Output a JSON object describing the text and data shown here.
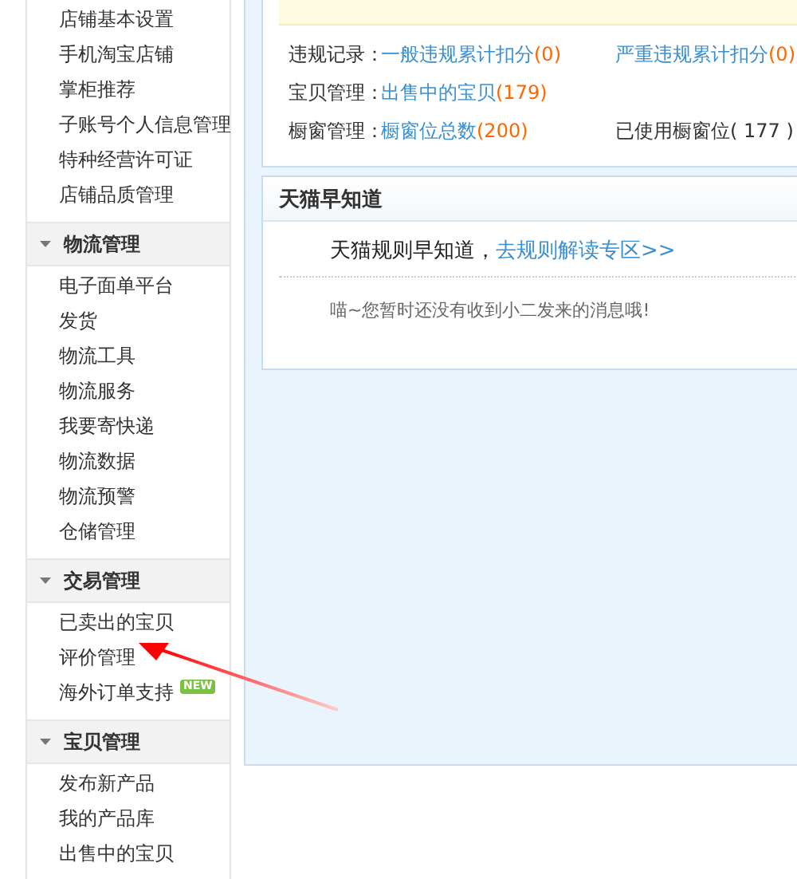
{
  "sidebar": {
    "groups": [
      {
        "items": [
          {
            "label": "店铺基本设置"
          },
          {
            "label": "手机淘宝店铺"
          },
          {
            "label": "掌柜推荐"
          },
          {
            "label": "子账号个人信息管理"
          },
          {
            "label": "特种经营许可证"
          },
          {
            "label": "店铺品质管理"
          }
        ]
      },
      {
        "title": "物流管理",
        "expanded": true,
        "items": [
          {
            "label": "电子面单平台"
          },
          {
            "label": "发货"
          },
          {
            "label": "物流工具"
          },
          {
            "label": "物流服务"
          },
          {
            "label": "我要寄快递"
          },
          {
            "label": "物流数据"
          },
          {
            "label": "物流预警"
          },
          {
            "label": "仓储管理"
          }
        ]
      },
      {
        "title": "交易管理",
        "expanded": true,
        "items": [
          {
            "label": "已卖出的宝贝"
          },
          {
            "label": "评价管理"
          },
          {
            "label": "海外订单支持",
            "badge": "NEW"
          }
        ]
      },
      {
        "title": "宝贝管理",
        "expanded": true,
        "items": [
          {
            "label": "发布新产品"
          },
          {
            "label": "我的产品库"
          },
          {
            "label": "出售中的宝贝"
          }
        ]
      }
    ]
  },
  "stats": [
    {
      "label": "违规记录：",
      "items": [
        {
          "kind": "link",
          "text": "一般违规累计扣分",
          "count": "(0)"
        },
        {
          "kind": "link",
          "text": "严重违规累计扣分",
          "count": "(0)"
        }
      ]
    },
    {
      "label": "宝贝管理：",
      "items": [
        {
          "kind": "link",
          "text": "出售中的宝贝",
          "count": "(179)"
        }
      ]
    },
    {
      "label": "橱窗管理：",
      "items": [
        {
          "kind": "link",
          "text": "橱窗位总数",
          "count": "(200)"
        },
        {
          "kind": "text",
          "text": "已使用橱窗位( 177 )"
        }
      ]
    }
  ],
  "news": {
    "title": "天猫早知道",
    "intro": "天猫规则早知道，",
    "link": "去规则解读专区>>",
    "message": "喵~您暂时还没有收到小二发来的消息哦!"
  }
}
